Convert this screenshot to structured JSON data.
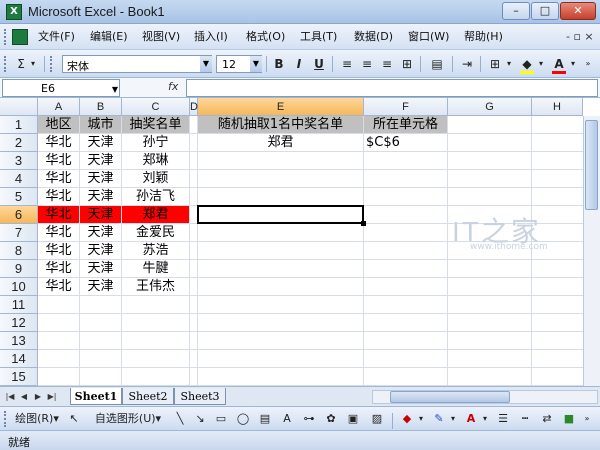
{
  "window": {
    "app_icon": "X",
    "title": "Microsoft Excel - Book1",
    "minimize": "–",
    "maximize": "□",
    "close": "✕"
  },
  "menubar": {
    "items": [
      "文件(F)",
      "编辑(E)",
      "视图(V)",
      "插入(I)",
      "格式(O)",
      "工具(T)",
      "数据(D)",
      "窗口(W)",
      "帮助(H)"
    ],
    "right": "- ▫ ×"
  },
  "toolbar": {
    "sigma": "Σ",
    "font_name": "宋体",
    "font_size": "12",
    "bold": "B",
    "italic": "I",
    "underline": "U",
    "align_left": "≡",
    "align_center": "≡",
    "align_right": "≡",
    "merge": "⊞",
    "indent": "⇥",
    "borders": "⊞",
    "fill_color": "◆",
    "font_color": "A",
    "fill_color_hex": "#ffff00",
    "font_color_hex": "#ff0000"
  },
  "formula": {
    "name_box": "E6",
    "fx": "fx",
    "value": ""
  },
  "grid": {
    "columns": [
      "A",
      "B",
      "C",
      "D",
      "E",
      "F",
      "G",
      "H"
    ],
    "selected_column": "E",
    "rows": [
      "1",
      "2",
      "3",
      "4",
      "5",
      "6",
      "7",
      "8",
      "9",
      "10",
      "11",
      "12",
      "13",
      "14",
      "15"
    ],
    "selected_row": "6",
    "data": [
      [
        "地区",
        "城市",
        "抽奖名单"
      ],
      [
        "华北",
        "天津",
        "孙宁"
      ],
      [
        "华北",
        "天津",
        "郑琳"
      ],
      [
        "华北",
        "天津",
        "刘颖"
      ],
      [
        "华北",
        "天津",
        "孙洁飞"
      ],
      [
        "华北",
        "天津",
        "郑君"
      ],
      [
        "华北",
        "天津",
        "金爱民"
      ],
      [
        "华北",
        "天津",
        "苏浩"
      ],
      [
        "华北",
        "天津",
        "牛腱"
      ],
      [
        "华北",
        "天津",
        "王伟杰"
      ]
    ],
    "e1": "随机抽取1名中奖名单",
    "f1": "所在单元格",
    "e2": "郑君",
    "f2": "$C$6",
    "highlight_color": "#ff0000",
    "header_fill": "#c0c0c0"
  },
  "sheets": {
    "tabs": [
      "Sheet1",
      "Sheet2",
      "Sheet3"
    ],
    "active": "Sheet1"
  },
  "drawbar": {
    "draw": "绘图(R)▾",
    "autoshapes": "自选图形(U)▾"
  },
  "status": {
    "text": "就绪"
  }
}
